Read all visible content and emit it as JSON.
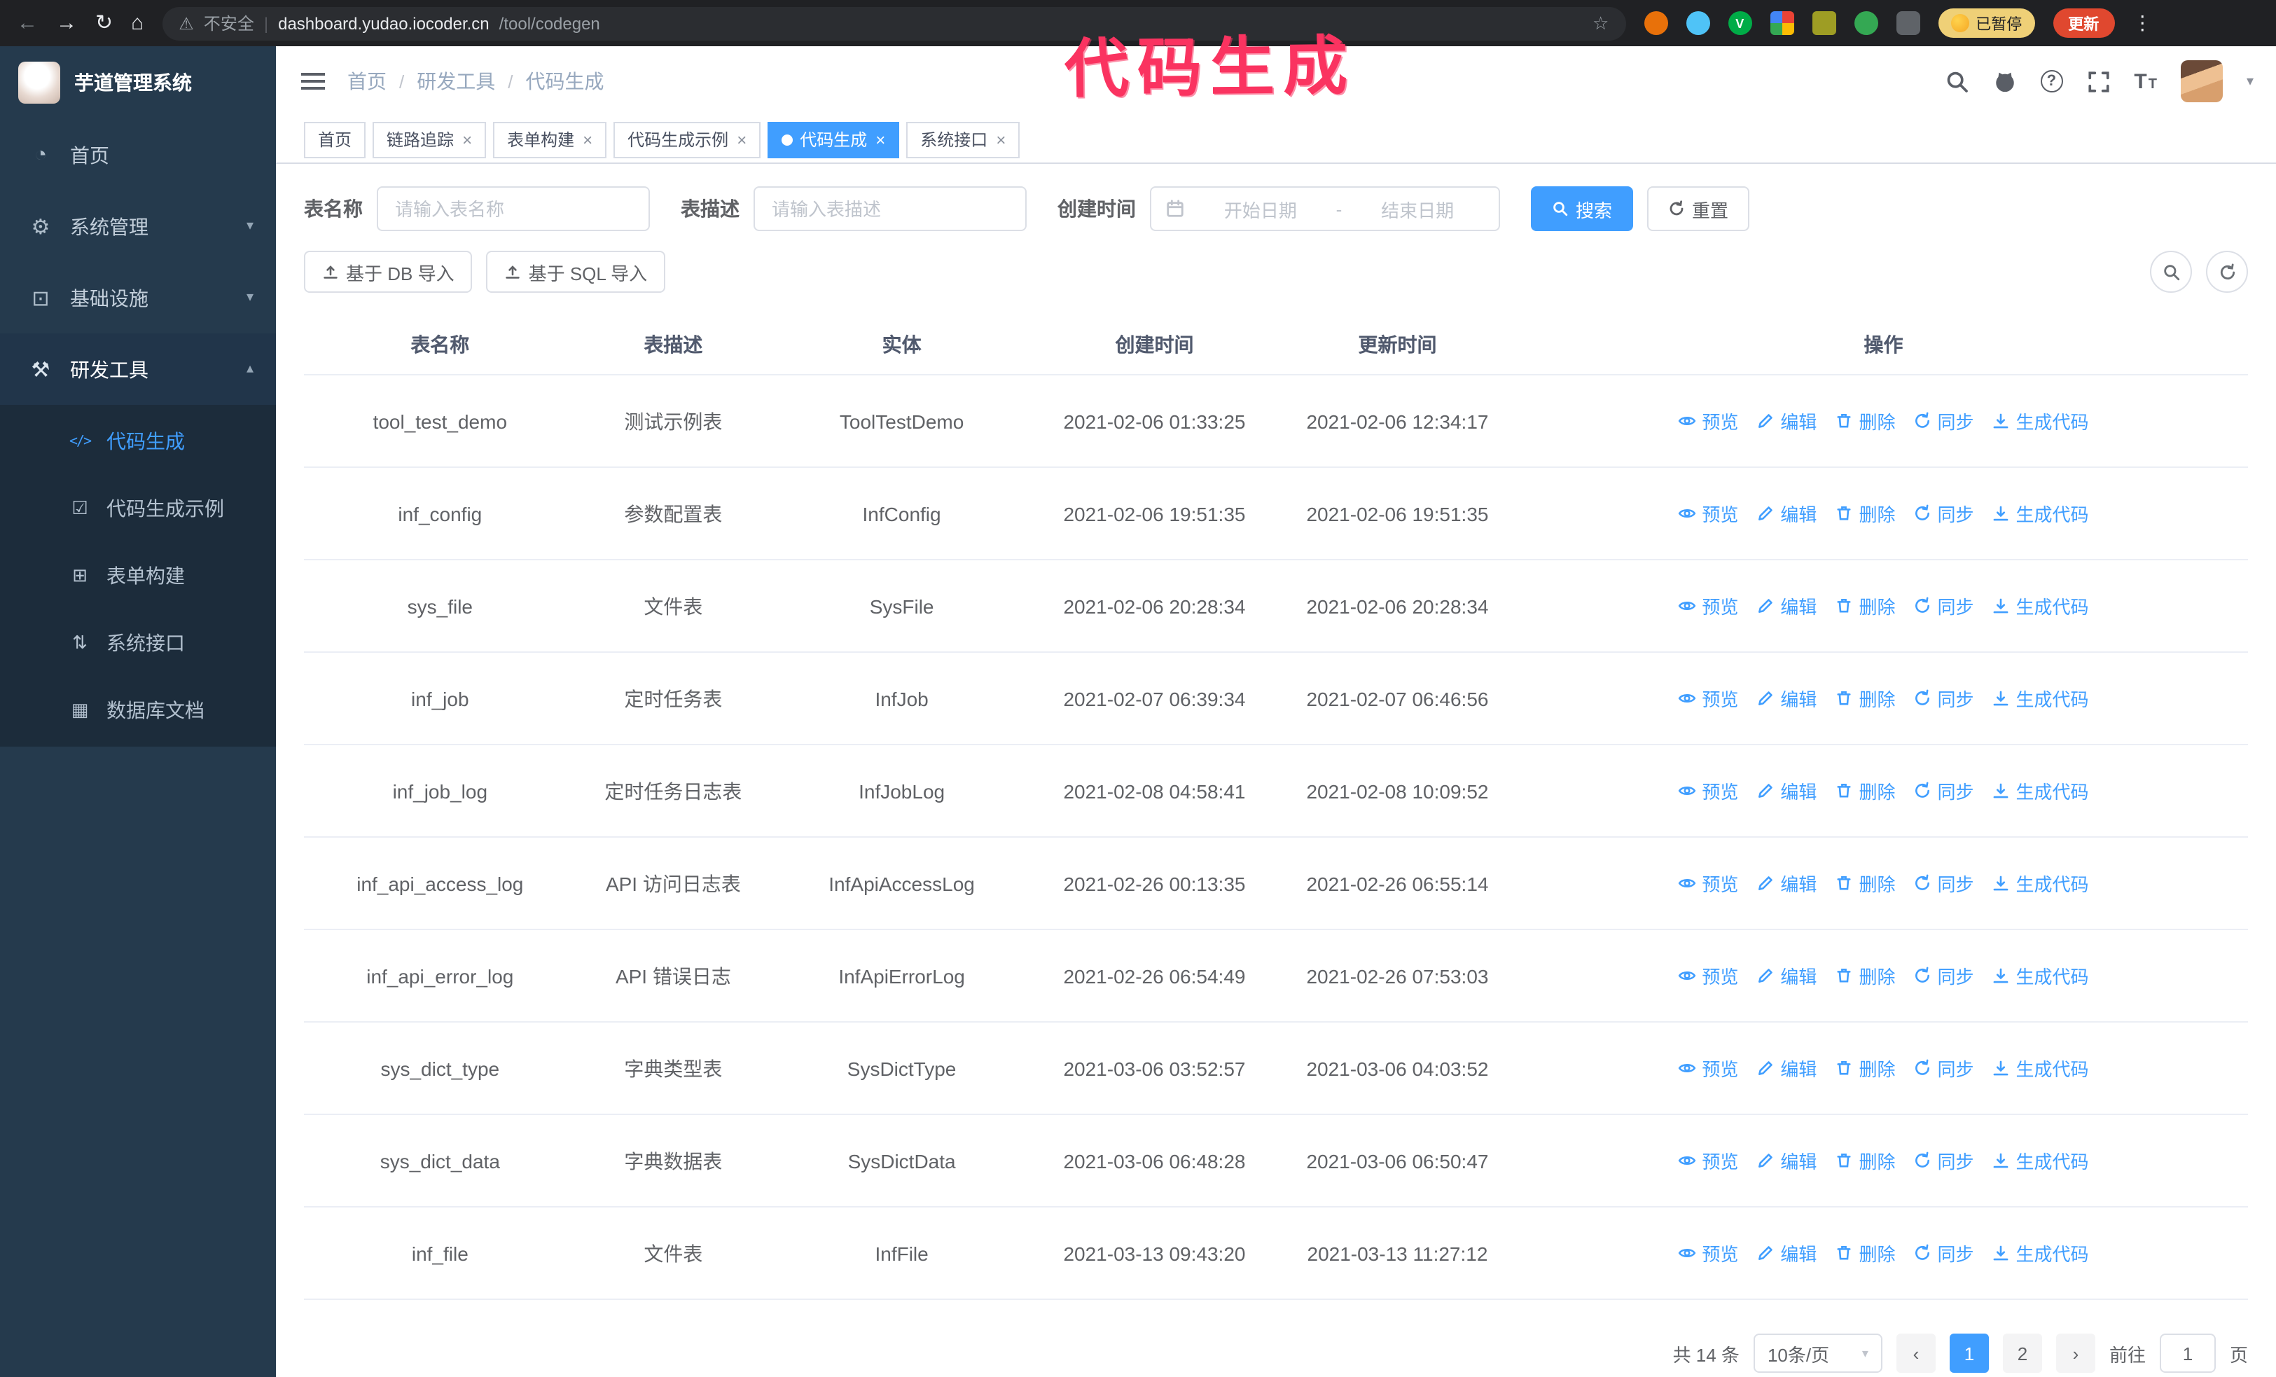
{
  "annotation": {
    "text": "代码生成",
    "color": "#fa3360"
  },
  "browser": {
    "security_label": "不安全",
    "domain": "dashboard.yudao.iocoder.cn",
    "path": "/tool/codegen",
    "paused_badge": "已暂停",
    "update_button": "更新",
    "extension_check_letter": "V"
  },
  "icons": {
    "back": "←",
    "forward": "→",
    "reload": "↻",
    "home": "⌂",
    "warning": "⚠",
    "divider": "|",
    "star": "☆",
    "menu_dots": "⋮",
    "help": "?",
    "fontsize_big": "T",
    "fontsize_small": "T",
    "caret_down": "▾",
    "caret_up": "▴",
    "close": "×",
    "prev": "‹",
    "next": "›",
    "range_separator": "-"
  },
  "sidebar": {
    "logo_title": "芋道管理系统",
    "items": [
      {
        "label": "首页",
        "glyph": "◔"
      },
      {
        "label": "系统管理",
        "glyph": "⚙",
        "chevron": "▾"
      },
      {
        "label": "基础设施",
        "glyph": "⊡",
        "chevron": "▾"
      },
      {
        "label": "研发工具",
        "glyph": "⚒",
        "chevron": "▴"
      }
    ],
    "subitems": [
      {
        "label": "代码生成",
        "glyph": "</>"
      },
      {
        "label": "代码生成示例",
        "glyph": "☑"
      },
      {
        "label": "表单构建",
        "glyph": "⊞"
      },
      {
        "label": "系统接口",
        "glyph": "⇅"
      },
      {
        "label": "数据库文档",
        "glyph": "▦"
      }
    ]
  },
  "header": {
    "breadcrumb": [
      "首页",
      "研发工具",
      "代码生成"
    ]
  },
  "tabs": [
    {
      "label": "首页"
    },
    {
      "label": "链路追踪"
    },
    {
      "label": "表单构建"
    },
    {
      "label": "代码生成示例"
    },
    {
      "label": "代码生成"
    },
    {
      "label": "系统接口"
    }
  ],
  "filters": {
    "name_label": "表名称",
    "name_placeholder": "请输入表名称",
    "desc_label": "表描述",
    "desc_placeholder": "请输入表描述",
    "time_label": "创建时间",
    "start_placeholder": "开始日期",
    "end_placeholder": "结束日期",
    "search_button": "搜索",
    "reset_button": "重置"
  },
  "toolbar": {
    "import_db_button": "基于 DB 导入",
    "import_sql_button": "基于 SQL 导入"
  },
  "table": {
    "headers": [
      "表名称",
      "表描述",
      "实体",
      "创建时间",
      "更新时间",
      "操作"
    ],
    "op_labels": [
      "预览",
      "编辑",
      "删除",
      "同步",
      "生成代码"
    ],
    "rows": [
      {
        "name": "tool_test_demo",
        "desc": "测试示例表",
        "entity": "ToolTestDemo",
        "created": "2021-02-06 01:33:25",
        "updated": "2021-02-06 12:34:17"
      },
      {
        "name": "inf_config",
        "desc": "参数配置表",
        "entity": "InfConfig",
        "created": "2021-02-06 19:51:35",
        "updated": "2021-02-06 19:51:35"
      },
      {
        "name": "sys_file",
        "desc": "文件表",
        "entity": "SysFile",
        "created": "2021-02-06 20:28:34",
        "updated": "2021-02-06 20:28:34"
      },
      {
        "name": "inf_job",
        "desc": "定时任务表",
        "entity": "InfJob",
        "created": "2021-02-07 06:39:34",
        "updated": "2021-02-07 06:46:56"
      },
      {
        "name": "inf_job_log",
        "desc": "定时任务日志表",
        "entity": "InfJobLog",
        "created": "2021-02-08 04:58:41",
        "updated": "2021-02-08 10:09:52"
      },
      {
        "name": "inf_api_access_log",
        "desc": "API 访问日志表",
        "entity": "InfApiAccessLog",
        "created": "2021-02-26 00:13:35",
        "updated": "2021-02-26 06:55:14"
      },
      {
        "name": "inf_api_error_log",
        "desc": "API 错误日志",
        "entity": "InfApiErrorLog",
        "created": "2021-02-26 06:54:49",
        "updated": "2021-02-26 07:53:03"
      },
      {
        "name": "sys_dict_type",
        "desc": "字典类型表",
        "entity": "SysDictType",
        "created": "2021-03-06 03:52:57",
        "updated": "2021-03-06 04:03:52"
      },
      {
        "name": "sys_dict_data",
        "desc": "字典数据表",
        "entity": "SysDictData",
        "created": "2021-03-06 06:48:28",
        "updated": "2021-03-06 06:50:47"
      },
      {
        "name": "inf_file",
        "desc": "文件表",
        "entity": "InfFile",
        "created": "2021-03-13 09:43:20",
        "updated": "2021-03-13 11:27:12"
      }
    ]
  },
  "pagination": {
    "total": "共 14 条",
    "page_size": "10条/页",
    "pages": [
      "1",
      "2"
    ],
    "goto_label": "前往",
    "goto_value": "1",
    "goto_suffix": "页"
  }
}
